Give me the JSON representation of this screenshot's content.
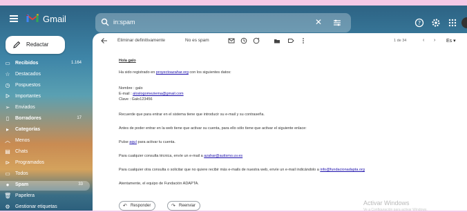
{
  "app": {
    "name": "Gmail"
  },
  "colors": {
    "brand_red": "#ea4335",
    "brand_blue": "#4285f4",
    "brand_green": "#34a853",
    "brand_yellow": "#fbbc04",
    "link": "#1a0dab"
  },
  "search": {
    "value": "in:spam"
  },
  "compose": {
    "label": "Redactar"
  },
  "sidebar": {
    "items": [
      {
        "label": "Recibidos",
        "count": "1.164",
        "icon": "inbox-icon"
      },
      {
        "label": "Destacados",
        "count": "",
        "icon": "star-icon"
      },
      {
        "label": "Pospuestos",
        "count": "",
        "icon": "clock-icon"
      },
      {
        "label": "Importantes",
        "count": "",
        "icon": "important-icon"
      },
      {
        "label": "Enviados",
        "count": "",
        "icon": "send-icon"
      },
      {
        "label": "Borradores",
        "count": "17",
        "icon": "draft-icon"
      },
      {
        "label": "Categorías",
        "count": "",
        "icon": "label-icon"
      },
      {
        "label": "Menos",
        "count": "",
        "icon": "chevron-up-icon"
      },
      {
        "label": "Chats",
        "count": "",
        "icon": "chat-icon"
      },
      {
        "label": "Programados",
        "count": "",
        "icon": "schedule-icon"
      },
      {
        "label": "Todos",
        "count": "",
        "icon": "mail-icon"
      },
      {
        "label": "Spam",
        "count": "33",
        "icon": "spam-icon"
      },
      {
        "label": "Papelera",
        "count": "",
        "icon": "trash-icon"
      },
      {
        "label": "Gestionar etiquetas",
        "count": "",
        "icon": "gear-icon"
      }
    ]
  },
  "toolbar": {
    "delete_forever": "Eliminar definitivamente",
    "not_spam": "No es spam",
    "pager": "1 de 34",
    "lang": "Es"
  },
  "email": {
    "greeting": "Hola galo",
    "line1_pre": "Ha sido registrado en ",
    "line1_link": "proyectoazahar.org",
    "line1_post": " con los siguientes datos:",
    "nombre": "Nombre : galo",
    "email_pre": "E-mail : ",
    "email_link": "aloslogomeziema@gmail.com",
    "clave": "Clave : Galo123456",
    "remember": "Recuerde que para entrar en el sistema tiene que introducir su e-mail y su contraseña.",
    "activate": "Antes de poder entrar en la web tiene que activar su cuenta, para ello sólo tiene que activar el siguiente enlace:",
    "click_pre": "Pulse ",
    "click_link": "aquí",
    "click_post": " para activar tu cuenta.",
    "tech_pre": "Para cualquier consulta técnica, envíe un e-mail a ",
    "tech_link": "azahar@autismo.uv.es",
    "other_pre": "Para cualquier otra consulta o solicitar que no quiere recibir más e-mails de nuestra web, envíe un e-mail indicándolo a ",
    "other_link": "info@fundacionadapta.org",
    "signature": "Atentamente, el equipo de Fundación ADAPTA."
  },
  "actions": {
    "reply": "Responder",
    "forward": "Reenviar"
  },
  "watermark": {
    "title": "Activar Windows",
    "subtitle": "Ve a Configuración para activar Windows."
  }
}
